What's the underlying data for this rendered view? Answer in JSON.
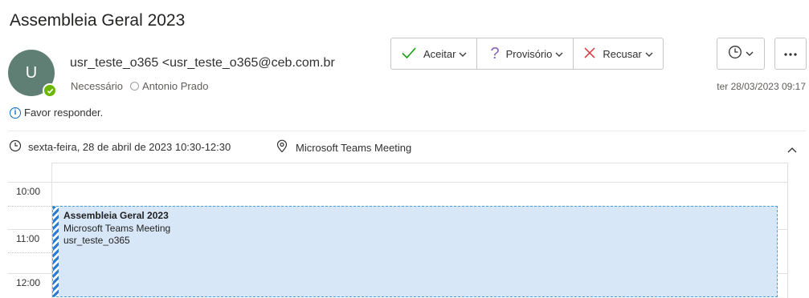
{
  "header": {
    "title": "Assembleia Geral 2023"
  },
  "sender": {
    "avatar_initial": "U",
    "name": "usr_teste_o365 <usr_teste_o365@ceb.com.br",
    "required_label": "Necessário",
    "attendee": "Antonio Prado",
    "date": "ter 28/03/2023 09:17"
  },
  "actions": {
    "accept": "Aceitar",
    "tentative": "Provisório",
    "decline": "Recusar"
  },
  "info": {
    "text": "Favor responder."
  },
  "meeting": {
    "when": "sexta-feira, 28 de abril de 2023 10:30-12:30",
    "location": "Microsoft Teams Meeting"
  },
  "calendar": {
    "times": [
      "10:00",
      "11:00",
      "12:00"
    ],
    "event": {
      "title": "Assembleia Geral 2023",
      "location": "Microsoft Teams Meeting",
      "organizer": "usr_teste_o365"
    }
  },
  "colors": {
    "accept": "#13a10e",
    "tentative": "#8764b8",
    "decline": "#d13438",
    "event_fill": "#d7e7f8",
    "event_border": "#2b7bd1",
    "presence": "#6bb700",
    "avatar": "#5f7f74"
  },
  "icons": [
    "check-icon",
    "question-icon",
    "x-icon",
    "clock-icon",
    "more-icon",
    "info-icon",
    "location-pin-icon",
    "chevron-up-icon",
    "chevron-down-icon"
  ]
}
